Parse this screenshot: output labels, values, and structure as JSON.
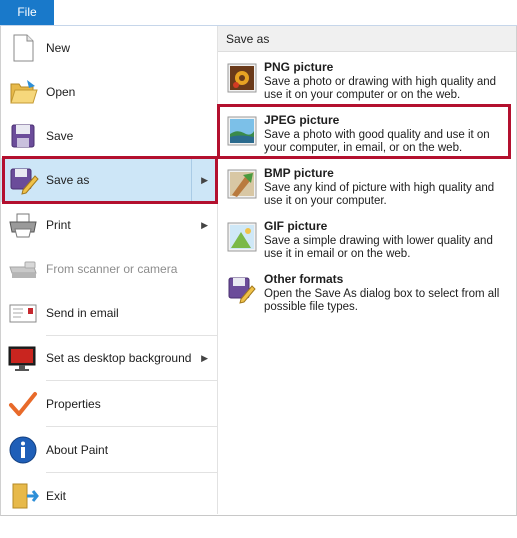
{
  "file_tab": "File",
  "menu": {
    "items": [
      {
        "id": "new",
        "label": "New"
      },
      {
        "id": "open",
        "label": "Open"
      },
      {
        "id": "save",
        "label": "Save"
      },
      {
        "id": "save_as",
        "label": "Save as"
      },
      {
        "id": "print",
        "label": "Print"
      },
      {
        "id": "scanner",
        "label": "From scanner or camera"
      },
      {
        "id": "email",
        "label": "Send in email"
      },
      {
        "id": "desktop",
        "label": "Set as desktop background"
      },
      {
        "id": "properties",
        "label": "Properties"
      },
      {
        "id": "about",
        "label": "About Paint"
      },
      {
        "id": "exit",
        "label": "Exit"
      }
    ],
    "submenu_arrow": "▶"
  },
  "save_as_panel": {
    "header": "Save as",
    "options": [
      {
        "title": "PNG picture",
        "desc": "Save a photo or drawing with high quality and use it on your computer or on the web."
      },
      {
        "title": "JPEG picture",
        "desc": "Save a photo with good quality and use it on your computer, in email, or on the web."
      },
      {
        "title": "BMP picture",
        "desc": "Save any kind of picture with high quality and use it on your computer."
      },
      {
        "title": "GIF picture",
        "desc": "Save a simple drawing with lower quality and use it in email or on the web."
      },
      {
        "title": "Other formats",
        "desc": "Open the Save As dialog box to select from all possible file types."
      }
    ]
  },
  "colors": {
    "file_tab_bg": "#1979ca",
    "selected_bg": "#cde6f7",
    "highlight_border": "#b3102e"
  },
  "icons": {
    "new": "new-document-icon",
    "open": "folder-open-icon",
    "save": "floppy-disk-icon",
    "save_as": "save-as-icon",
    "print": "printer-icon",
    "scanner": "scanner-icon",
    "email": "email-icon",
    "desktop": "desktop-background-icon",
    "properties": "checkmark-icon",
    "about": "info-icon",
    "exit": "exit-icon",
    "png": "png-picture-icon",
    "jpeg": "jpeg-picture-icon",
    "bmp": "bmp-picture-icon",
    "gif": "gif-picture-icon",
    "other": "other-formats-icon"
  }
}
